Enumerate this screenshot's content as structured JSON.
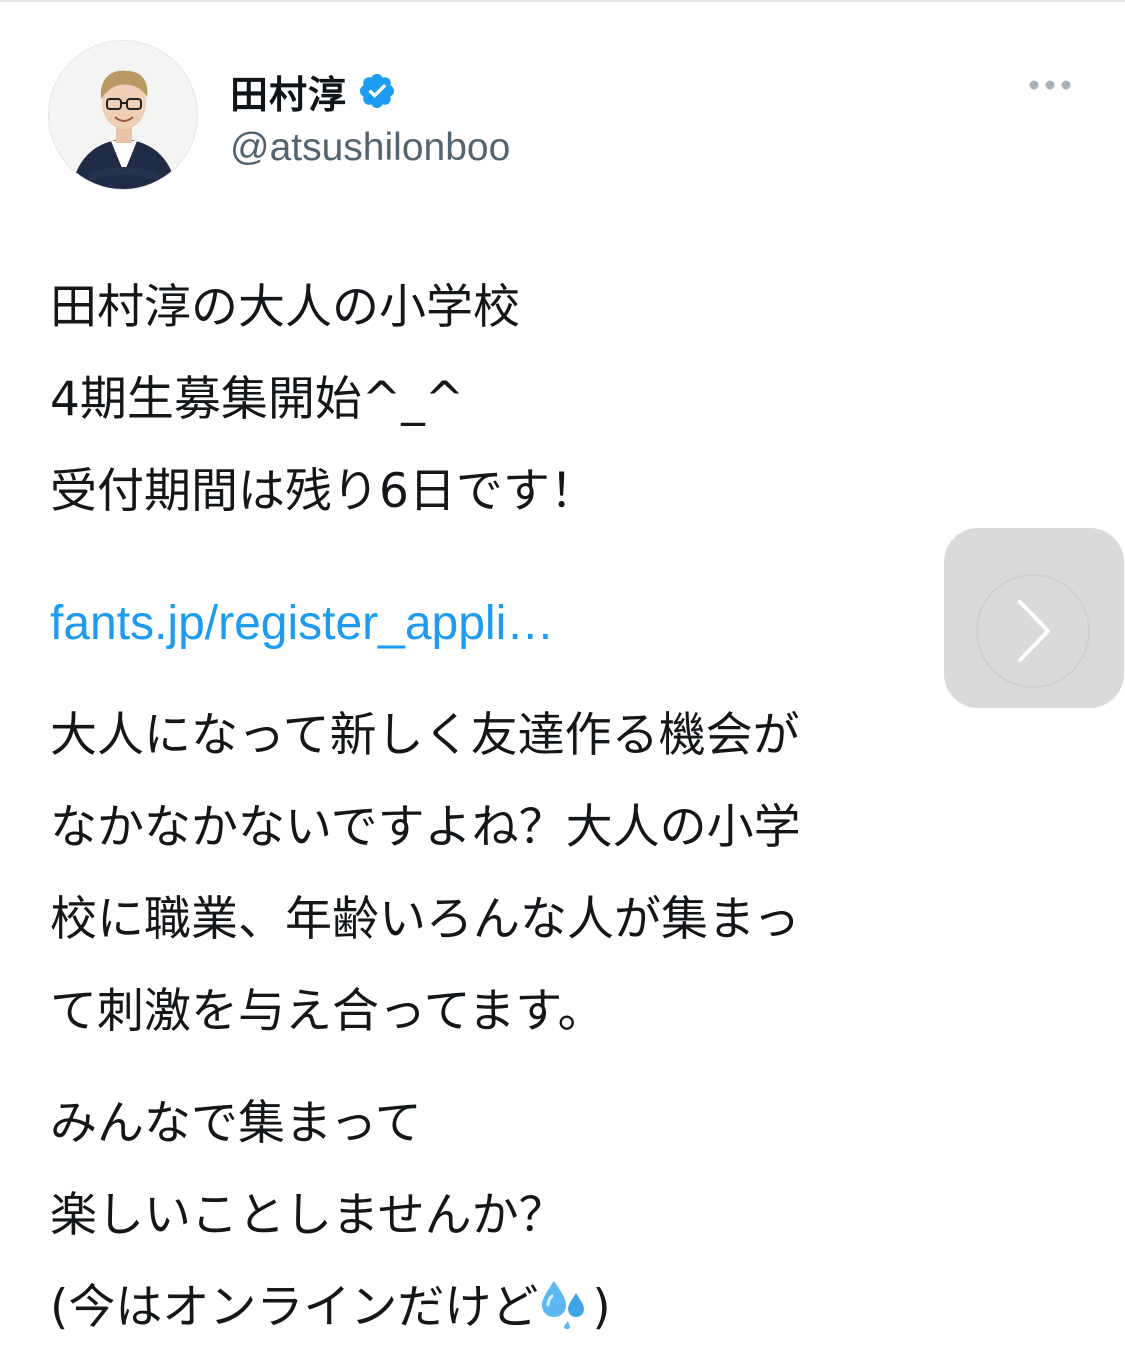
{
  "author": {
    "display_name": "田村淳",
    "handle": "@atsushilonboo",
    "verified": true
  },
  "icons": {
    "avatar": "avatar-photo",
    "verified": "verified-badge-icon",
    "more": "more-horizontal-icon",
    "next": "chevron-right-icon",
    "sweat": "sweat-droplets-icon"
  },
  "tweet": {
    "para1": [
      "田村淳の大人の小学校",
      "4期生募集開始^_^",
      "受付期間は残り6日です！"
    ],
    "link": "fants.jp/register_appli…",
    "para2": [
      "大人になって新しく友達作る機会が",
      "なかなかないですよね？大人の小学",
      "校に職業、年齢いろんな人が集まっ",
      "て刺激を与え合ってます。"
    ],
    "para3": [
      "みんなで集まって",
      "楽しいことしませんか？"
    ],
    "last_line_text": "(今はオンラインだけど",
    "last_line_close": ")"
  },
  "colors": {
    "link": "#1d9bf0",
    "verified": "#1d9bf0",
    "handle": "#536471"
  }
}
